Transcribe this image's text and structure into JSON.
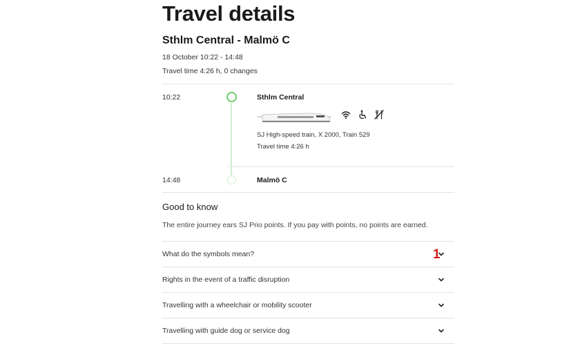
{
  "page": {
    "title": "Travel details",
    "route": "Sthlm Central - Malmö C",
    "date_time": "18 October 10:22 - 14:48",
    "travel_summary": "Travel time 4:26 h, 0 changes"
  },
  "journey": {
    "departure": {
      "time": "10:22",
      "station": "Sthlm Central"
    },
    "arrival": {
      "time": "14:48",
      "station": "Malmö C"
    },
    "train_info": "SJ High-speed train, X 2000, Train 529",
    "travel_time": "Travel time 4:26 h",
    "amenities": [
      "wifi-icon",
      "wheelchair-icon",
      "no-food-icon"
    ]
  },
  "good_to_know": {
    "title": "Good to know",
    "text": "The entire journey ears SJ Prio points. If you pay with points, no points are earned."
  },
  "accordion": [
    {
      "label": "What do the symbols mean?"
    },
    {
      "label": "Rights in the event of a traffic disruption"
    },
    {
      "label": "Travelling with a wheelchair or mobility scooter"
    },
    {
      "label": "Travelling with guide dog or service dog"
    }
  ],
  "annotation": {
    "marker": "1"
  },
  "colors": {
    "accent_green": "#6ccf6a",
    "timeline_green": "#cfeecd",
    "marker_red": "#d11a1a"
  }
}
